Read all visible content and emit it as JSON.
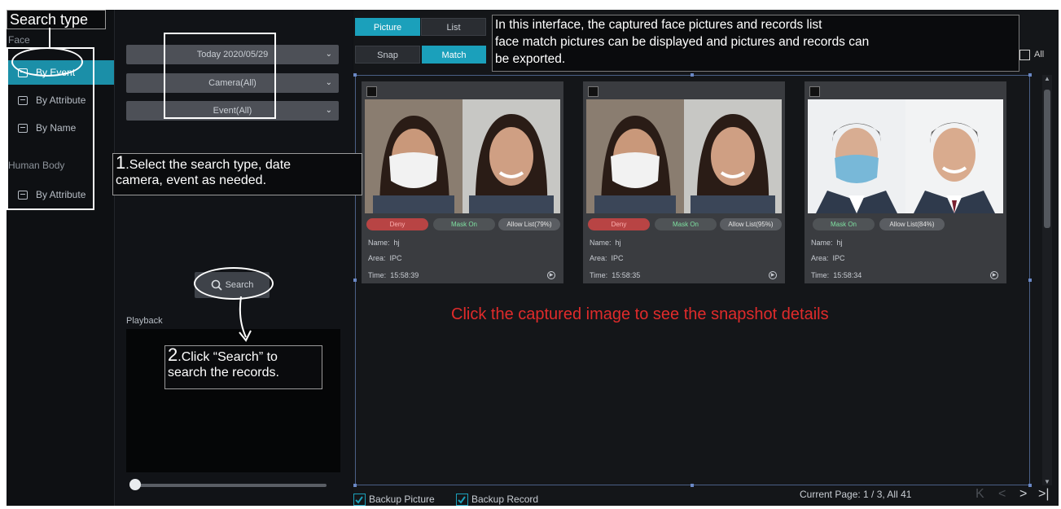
{
  "nav": {
    "face_header": "Face",
    "human_body_header": "Human Body",
    "items": [
      {
        "label": "By Event",
        "active": true
      },
      {
        "label": "By Attribute",
        "active": false
      },
      {
        "label": "By Name",
        "active": false
      },
      {
        "label": "By Attribute",
        "active": false
      }
    ]
  },
  "filters": {
    "date": "Today 2020/05/29",
    "camera": "Camera(All)",
    "event": "Event(All)",
    "search_label": "Search",
    "playback_label": "Playback"
  },
  "playback": {
    "slider_position": 0.0
  },
  "tabs": {
    "picture": "Picture",
    "list": "List",
    "snap": "Snap",
    "match": "Match",
    "selected_view": "Picture",
    "selected_mode": "Match"
  },
  "select_all_label": "All",
  "cards": [
    {
      "tags": [
        "Deny",
        "Mask On",
        "Allow List(79%)"
      ],
      "name_label": "Name:",
      "name": "hj",
      "area_label": "Area:",
      "area": "IPC",
      "time_label": "Time:",
      "time": "15:58:39"
    },
    {
      "tags": [
        "Deny",
        "Mask On",
        "Allow List(95%)"
      ],
      "name_label": "Name:",
      "name": "hj",
      "area_label": "Area:",
      "area": "IPC",
      "time_label": "Time:",
      "time": "15:58:35"
    },
    {
      "tags": [
        "Mask On",
        "Allow List(84%)"
      ],
      "name_label": "Name:",
      "name": "hj",
      "area_label": "Area:",
      "area": "IPC",
      "time_label": "Time:",
      "time": "15:58:34"
    }
  ],
  "footer": {
    "backup_picture": "Backup Picture",
    "backup_record": "Backup Record",
    "page_info": "Current Page: 1 / 3, All 41",
    "first_glyph": "K",
    "prev_glyph": "<",
    "next_glyph": ">",
    "last_glyph": ">|"
  },
  "annotations": {
    "search_type": "Search type",
    "step1_num": "1",
    "step1_text_a": ".Select the search type, date",
    "step1_text_b": "camera, event as needed.",
    "step2_num": "2",
    "step2_text_a": ".Click “Search” to",
    "step2_text_b": "search the records.",
    "info_line1": "In this interface, the captured face pictures and records list",
    "info_line2": "face match pictures can be displayed and pictures and records can",
    "info_line3": "be exported.",
    "red_note": "Click the captured image to see the snapshot details"
  },
  "colors": {
    "accent": "#1ba0bb",
    "nav_active": "#1b8fa8",
    "note_red": "#e02b2b"
  }
}
